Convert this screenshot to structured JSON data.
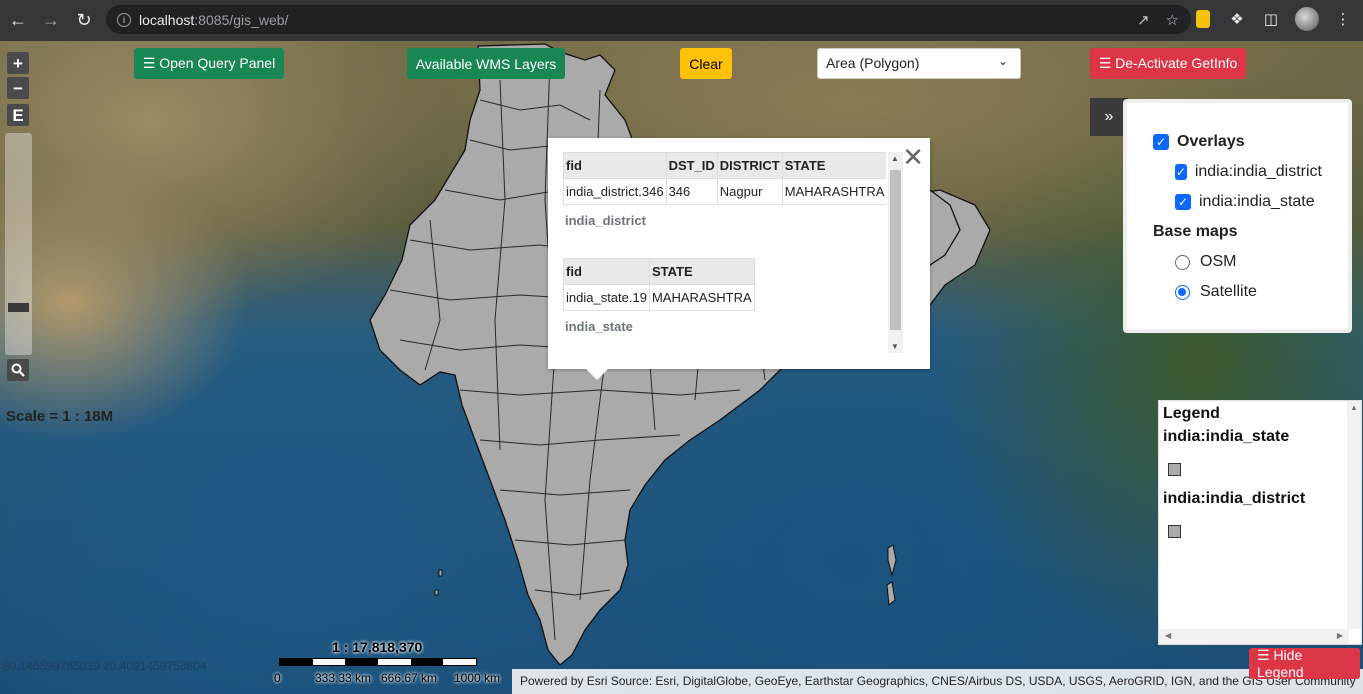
{
  "browser": {
    "url_host": "localhost",
    "url_path": ":8085/gis_web/"
  },
  "toolbar": {
    "query_panel_label": "☰ Open Query Panel",
    "wms_layers_label": "Available WMS Layers",
    "clear_label": "Clear",
    "measure_select_value": "Area (Polygon)",
    "getinfo_label": "☰ De-Activate GetInfo"
  },
  "map_controls": {
    "zoom_in": "+",
    "zoom_out": "−",
    "extent": "E",
    "scale_text": "Scale = 1 : 18M",
    "coords": "80.145599785039 20.4091459758804"
  },
  "scalebar": {
    "ratio": "1 : 17,818,370",
    "labels": [
      "0",
      "333.33 km",
      "666.67 km",
      "1000 km"
    ]
  },
  "attribution": "Powered by Esri Source: Esri, DigitalGlobe, GeoEye, Earthstar Geographics, CNES/Airbus DS, USDA, USGS, AeroGRID, IGN, and the GIS User Community",
  "popup": {
    "district_table": {
      "headers": [
        "fid",
        "DST_ID",
        "DISTRICT",
        "STATE"
      ],
      "row": [
        "india_district.346",
        "346",
        "Nagpur",
        "MAHARASHTRA"
      ],
      "caption": "india_district"
    },
    "state_table": {
      "headers": [
        "fid",
        "STATE"
      ],
      "row": [
        "india_state.19",
        "MAHARASHTRA"
      ],
      "caption": "india_state"
    }
  },
  "layer_switcher": {
    "toggle": "»",
    "overlays_label": "Overlays",
    "overlay_items": [
      "india:india_district",
      "india:india_state"
    ],
    "basemaps_label": "Base maps",
    "basemap_items": [
      "OSM",
      "Satellite"
    ],
    "selected_basemap": "Satellite"
  },
  "legend": {
    "title": "Legend",
    "layers": [
      "india:india_state",
      "india:india_district"
    ]
  },
  "hide_legend_label": "☰ Hide Legend",
  "colors": {
    "green": "#198754",
    "yellow": "#ffc107",
    "red": "#dc3545",
    "checkbox_blue": "#0b68ff",
    "india_fill": "#aaaaaa"
  }
}
